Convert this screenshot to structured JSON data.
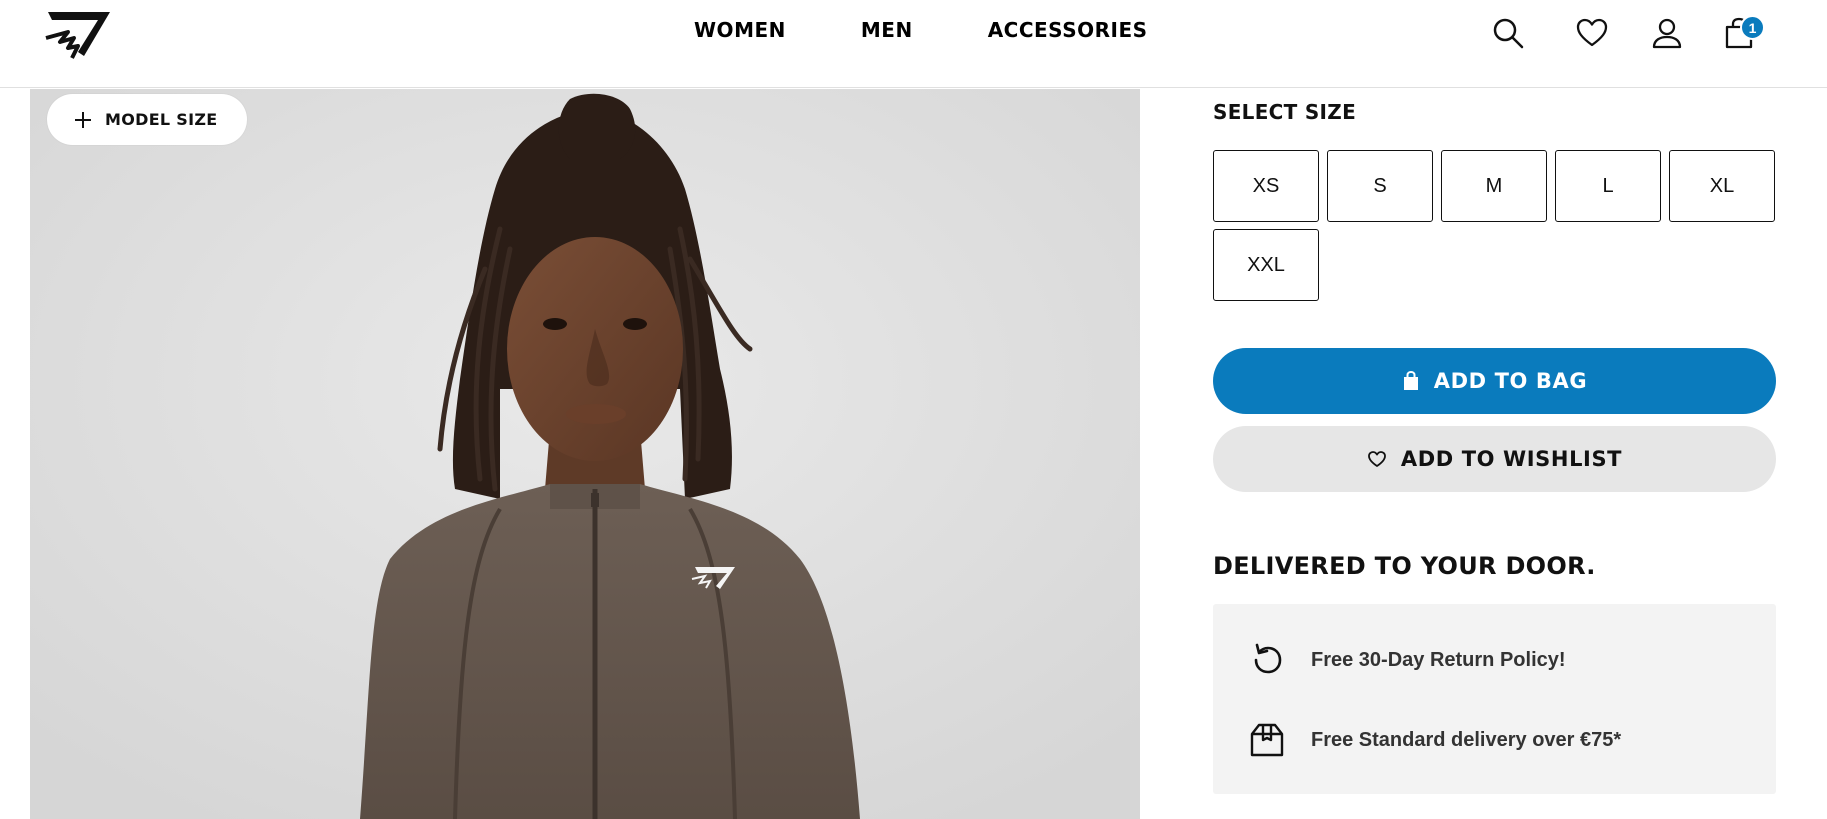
{
  "header": {
    "nav": [
      {
        "label": "WOMEN"
      },
      {
        "label": "MEN"
      },
      {
        "label": "ACCESSORIES"
      }
    ],
    "icons": [
      "search-icon",
      "heart-icon",
      "account-icon",
      "cart-icon"
    ],
    "cart_count": "1"
  },
  "product": {
    "model_size_label": "MODEL SIZE",
    "select_size_title": "SELECT SIZE",
    "sizes": [
      "XS",
      "S",
      "M",
      "L",
      "XL",
      "XXL"
    ],
    "add_to_bag_label": "ADD TO BAG",
    "add_to_wishlist_label": "ADD TO WISHLIST"
  },
  "delivery": {
    "title": "DELIVERED TO YOUR DOOR.",
    "items": [
      {
        "icon": "return-icon",
        "text": "Free 30-Day Return Policy!"
      },
      {
        "icon": "package-icon",
        "text": "Free Standard delivery over €75*"
      }
    ]
  },
  "colors": {
    "accent_blue": "#0a7bbd",
    "wishlist_bg": "#e6e6e6",
    "info_bg": "#f3f3f3"
  }
}
